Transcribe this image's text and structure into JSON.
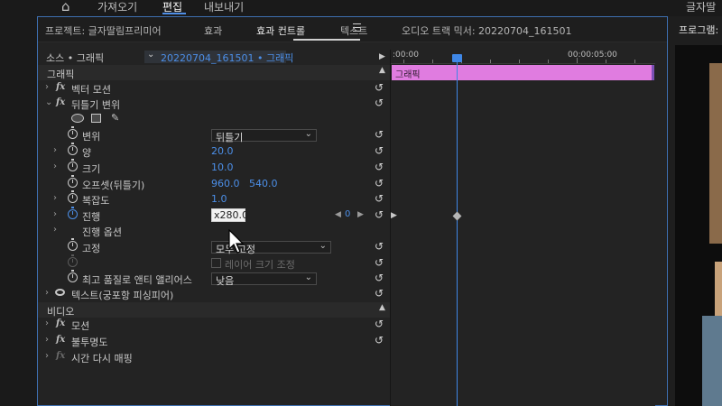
{
  "workspace_bar": {
    "items": [
      "가져오기",
      "편집",
      "내보내기"
    ],
    "active": "편집",
    "right_title": "글자딸"
  },
  "tabs": [
    {
      "label": "프로젝트: 글자딸림프리미어"
    },
    {
      "label": "효과"
    },
    {
      "label": "효과 컨트롤",
      "active": true
    },
    {
      "label": "텍스트"
    },
    {
      "label": "오디오 트랙 믹서: 20220704_161501"
    }
  ],
  "source": {
    "label": "소스 • 그래픽",
    "clip": "20220704_161501 • 그래픽"
  },
  "sections": {
    "graphics": "그래픽",
    "video": "비디오"
  },
  "effects": {
    "vector_motion": "벡터 모션",
    "warp": "뒤틀기 변위",
    "warp_props": {
      "displacement": {
        "label": "변위",
        "value": "뒤틀기"
      },
      "amount": {
        "label": "양",
        "value": "20.0"
      },
      "size": {
        "label": "크기",
        "value": "10.0"
      },
      "offset": {
        "label": "오프셋(뒤틀기)",
        "x": "960.0",
        "y": "540.0"
      },
      "complexity": {
        "label": "복잡도",
        "value": "1.0"
      },
      "evolution": {
        "label": "진행",
        "value": "x280.0"
      },
      "evolution_options": {
        "label": "진행 옵션"
      },
      "pinning": {
        "label": "고정",
        "value": "모두 고정"
      },
      "resize_layer": {
        "label": "레이어 크기 조정"
      },
      "antialias": {
        "label": "최고 품질로 앤티 앨리어스",
        "value": "낮음"
      }
    },
    "text_layer": "텍스트(궁포항 피싱피어)",
    "motion": "모션",
    "opacity": "불투명도",
    "time_remap": "시간 다시 매핑"
  },
  "timeline": {
    "timecodes": [
      ":00:00",
      "00:00:05:00"
    ],
    "clip_label": "그래픽",
    "keyframe_value": "0"
  },
  "program_monitor": {
    "tab": "프로그램:"
  },
  "colors": {
    "accent_blue": "#4c8fe8",
    "clip_pink": "#e07ce0",
    "playhead": "#3f87e6"
  },
  "icons": [
    "home-icon",
    "fx-icon",
    "stopwatch-icon",
    "reset-icon",
    "eye-icon",
    "ellipse-tool-icon",
    "rect-tool-icon",
    "pen-tool-icon",
    "keyframe-icon",
    "mouse-cursor-icon"
  ]
}
